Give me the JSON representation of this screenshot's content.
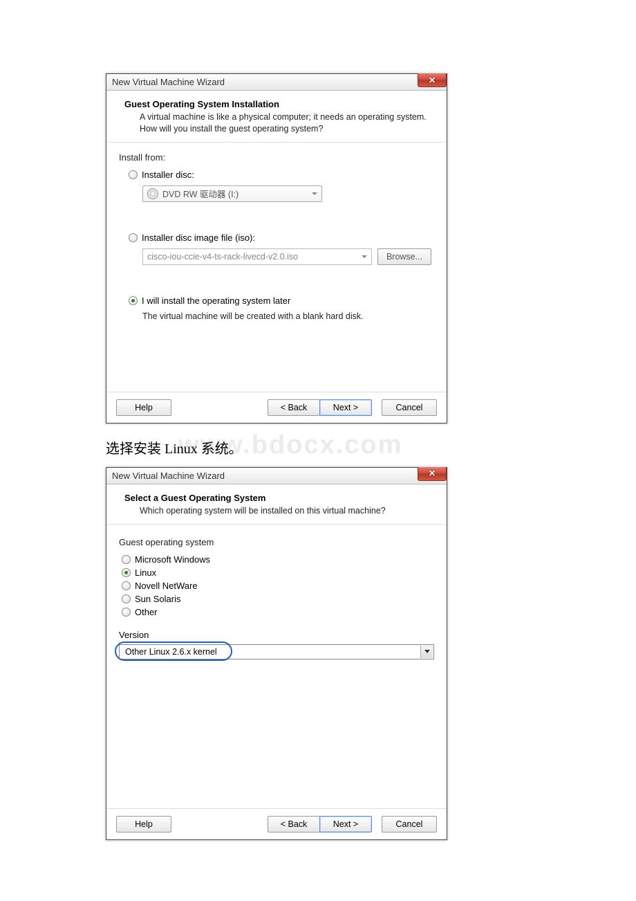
{
  "dialog1": {
    "title": "New Virtual Machine Wizard",
    "header_title": "Guest Operating System Installation",
    "header_subtitle": "A virtual machine is like a physical computer; it needs an operating system. How will you install the guest operating system?",
    "install_from_label": "Install from:",
    "opt_disc_label": "Installer disc:",
    "disc_dropdown_value": "DVD RW 驱动器 (I:)",
    "opt_iso_label": "Installer disc image file (iso):",
    "iso_value": "cisco-iou-ccie-v4-ts-rack-livecd-v2.0.iso",
    "browse_label": "Browse...",
    "opt_later_label": "I will install the operating system later",
    "later_desc": "The virtual machine will be created with a blank hard disk.",
    "selected_option": "later",
    "buttons": {
      "help": "Help",
      "back": "< Back",
      "next": "Next >",
      "cancel": "Cancel"
    }
  },
  "caption": "选择安装 Linux 系统。",
  "watermark": "www.bdocx.com",
  "dialog2": {
    "title": "New Virtual Machine Wizard",
    "header_title": "Select a Guest Operating System",
    "header_subtitle": "Which operating system will be installed on this virtual machine?",
    "group_label": "Guest operating system",
    "os_options": [
      {
        "label": "Microsoft Windows",
        "selected": false
      },
      {
        "label": "Linux",
        "selected": true
      },
      {
        "label": "Novell NetWare",
        "selected": false
      },
      {
        "label": "Sun Solaris",
        "selected": false
      },
      {
        "label": "Other",
        "selected": false
      }
    ],
    "version_label": "Version",
    "version_value": "Other Linux 2.6.x kernel",
    "buttons": {
      "help": "Help",
      "back": "< Back",
      "next": "Next >",
      "cancel": "Cancel"
    }
  }
}
